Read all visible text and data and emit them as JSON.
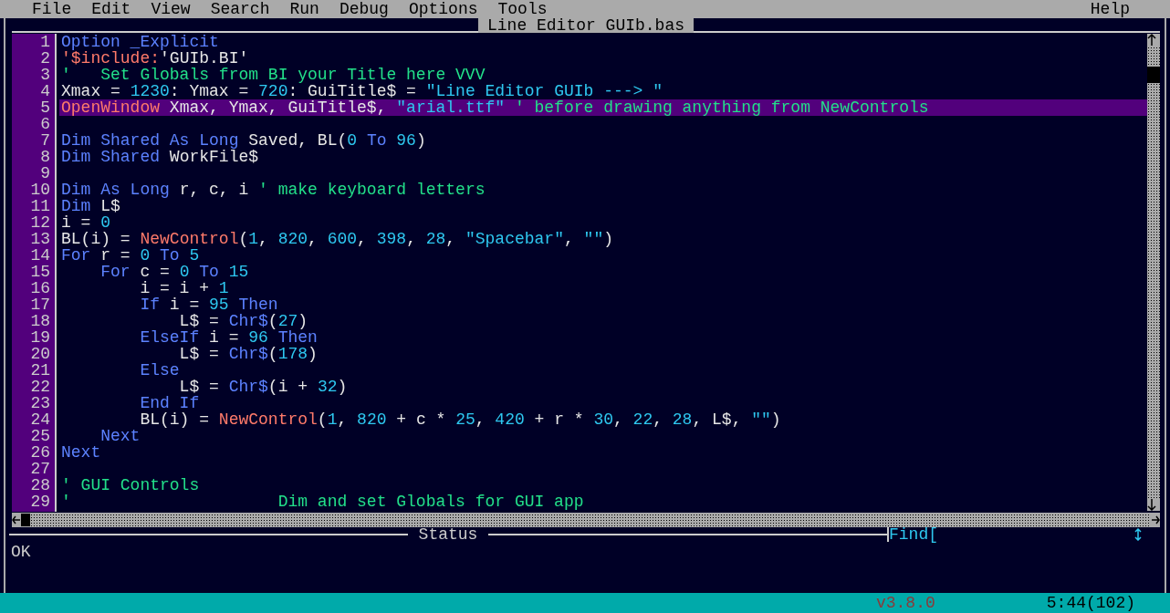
{
  "menu": [
    "File",
    "Edit",
    "View",
    "Search",
    "Run",
    "Debug",
    "Options",
    "Tools"
  ],
  "help": "Help",
  "editor": {
    "title": "Line Editor GUIb.bas",
    "lines": [
      {
        "number": "1",
        "selected": false,
        "tokens": [
          {
            "kind": "keyword",
            "text": "Option _Explicit"
          }
        ]
      },
      {
        "number": "2",
        "selected": false,
        "tokens": [
          {
            "kind": "metacommand",
            "text": "'$include:"
          },
          {
            "kind": "plain",
            "text": "'GUIb.BI'"
          }
        ]
      },
      {
        "number": "3",
        "selected": false,
        "tokens": [
          {
            "kind": "comment",
            "text": "'   Set Globals from BI your Title here VVV"
          }
        ]
      },
      {
        "number": "4",
        "selected": false,
        "tokens": [
          {
            "kind": "plain",
            "text": "Xmax = "
          },
          {
            "kind": "number",
            "text": "1230"
          },
          {
            "kind": "plain",
            "text": ": Ymax = "
          },
          {
            "kind": "number",
            "text": "720"
          },
          {
            "kind": "plain",
            "text": ": GuiTitle$ = "
          },
          {
            "kind": "string",
            "text": "\"Line Editor GUIb ---> \""
          }
        ]
      },
      {
        "number": "5",
        "selected": true,
        "tokens": [
          {
            "kind": "function",
            "text": "OpenWindow"
          },
          {
            "kind": "plain",
            "text": " Xmax, Ymax, GuiTitle$, "
          },
          {
            "kind": "string",
            "text": "\"arial.ttf\""
          },
          {
            "kind": "comment",
            "text": " ' before drawing anything from NewControls"
          }
        ]
      },
      {
        "number": "6",
        "selected": false
      },
      {
        "number": "7",
        "selected": false,
        "tokens": [
          {
            "kind": "keyword",
            "text": "Dim Shared As Long"
          },
          {
            "kind": "plain",
            "text": " Saved, BL("
          },
          {
            "kind": "number",
            "text": "0"
          },
          {
            "kind": "keyword",
            "text": " To "
          },
          {
            "kind": "number",
            "text": "96"
          },
          {
            "kind": "plain",
            "text": ")"
          }
        ]
      },
      {
        "number": "8",
        "selected": false,
        "tokens": [
          {
            "kind": "keyword",
            "text": "Dim Shared"
          },
          {
            "kind": "plain",
            "text": " WorkFile$"
          }
        ]
      },
      {
        "number": "9",
        "selected": false
      },
      {
        "number": "10",
        "selected": false,
        "tokens": [
          {
            "kind": "keyword",
            "text": "Dim As Long"
          },
          {
            "kind": "plain",
            "text": " r, c, i "
          },
          {
            "kind": "comment",
            "text": "' make keyboard letters"
          }
        ]
      },
      {
        "number": "11",
        "selected": false,
        "tokens": [
          {
            "kind": "keyword",
            "text": "Dim"
          },
          {
            "kind": "plain",
            "text": " L$"
          }
        ]
      },
      {
        "number": "12",
        "selected": false,
        "tokens": [
          {
            "kind": "plain",
            "text": "i = "
          },
          {
            "kind": "number",
            "text": "0"
          }
        ]
      },
      {
        "number": "13",
        "selected": false,
        "tokens": [
          {
            "kind": "plain",
            "text": "BL(i) = "
          },
          {
            "kind": "function",
            "text": "NewControl"
          },
          {
            "kind": "plain",
            "text": "("
          },
          {
            "kind": "number",
            "text": "1"
          },
          {
            "kind": "plain",
            "text": ", "
          },
          {
            "kind": "number",
            "text": "820"
          },
          {
            "kind": "plain",
            "text": ", "
          },
          {
            "kind": "number",
            "text": "600"
          },
          {
            "kind": "plain",
            "text": ", "
          },
          {
            "kind": "number",
            "text": "398"
          },
          {
            "kind": "plain",
            "text": ", "
          },
          {
            "kind": "number",
            "text": "28"
          },
          {
            "kind": "plain",
            "text": ", "
          },
          {
            "kind": "string",
            "text": "\"Spacebar\""
          },
          {
            "kind": "plain",
            "text": ", "
          },
          {
            "kind": "string",
            "text": "\"\""
          },
          {
            "kind": "plain",
            "text": ")"
          }
        ]
      },
      {
        "number": "14",
        "selected": false,
        "tokens": [
          {
            "kind": "keyword",
            "text": "For"
          },
          {
            "kind": "plain",
            "text": " r = "
          },
          {
            "kind": "number",
            "text": "0"
          },
          {
            "kind": "keyword",
            "text": " To "
          },
          {
            "kind": "number",
            "text": "5"
          }
        ]
      },
      {
        "number": "15",
        "selected": false,
        "tokens": [
          {
            "kind": "keyword",
            "text": "    For"
          },
          {
            "kind": "plain",
            "text": " c = "
          },
          {
            "kind": "number",
            "text": "0"
          },
          {
            "kind": "keyword",
            "text": " To "
          },
          {
            "kind": "number",
            "text": "15"
          }
        ]
      },
      {
        "number": "16",
        "selected": false,
        "tokens": [
          {
            "kind": "plain",
            "text": "        i = i + "
          },
          {
            "kind": "number",
            "text": "1"
          }
        ]
      },
      {
        "number": "17",
        "selected": false,
        "tokens": [
          {
            "kind": "keyword",
            "text": "        If"
          },
          {
            "kind": "plain",
            "text": " i = "
          },
          {
            "kind": "number",
            "text": "95"
          },
          {
            "kind": "keyword",
            "text": " Then"
          }
        ]
      },
      {
        "number": "18",
        "selected": false,
        "tokens": [
          {
            "kind": "plain",
            "text": "            L$ = "
          },
          {
            "kind": "keyword",
            "text": "Chr$"
          },
          {
            "kind": "plain",
            "text": "("
          },
          {
            "kind": "number",
            "text": "27"
          },
          {
            "kind": "plain",
            "text": ")"
          }
        ]
      },
      {
        "number": "19",
        "selected": false,
        "tokens": [
          {
            "kind": "keyword",
            "text": "        ElseIf"
          },
          {
            "kind": "plain",
            "text": " i = "
          },
          {
            "kind": "number",
            "text": "96"
          },
          {
            "kind": "keyword",
            "text": " Then"
          }
        ]
      },
      {
        "number": "20",
        "selected": false,
        "tokens": [
          {
            "kind": "plain",
            "text": "            L$ = "
          },
          {
            "kind": "keyword",
            "text": "Chr$"
          },
          {
            "kind": "plain",
            "text": "("
          },
          {
            "kind": "number",
            "text": "178"
          },
          {
            "kind": "plain",
            "text": ")"
          }
        ]
      },
      {
        "number": "21",
        "selected": false,
        "tokens": [
          {
            "kind": "keyword",
            "text": "        Else"
          }
        ]
      },
      {
        "number": "22",
        "selected": false,
        "tokens": [
          {
            "kind": "plain",
            "text": "            L$ = "
          },
          {
            "kind": "keyword",
            "text": "Chr$"
          },
          {
            "kind": "plain",
            "text": "(i + "
          },
          {
            "kind": "number",
            "text": "32"
          },
          {
            "kind": "plain",
            "text": ")"
          }
        ]
      },
      {
        "number": "23",
        "selected": false,
        "tokens": [
          {
            "kind": "keyword",
            "text": "        End If"
          }
        ]
      },
      {
        "number": "24",
        "selected": false,
        "tokens": [
          {
            "kind": "plain",
            "text": "        BL(i) = "
          },
          {
            "kind": "function",
            "text": "NewControl"
          },
          {
            "kind": "plain",
            "text": "("
          },
          {
            "kind": "number",
            "text": "1"
          },
          {
            "kind": "plain",
            "text": ", "
          },
          {
            "kind": "number",
            "text": "820"
          },
          {
            "kind": "plain",
            "text": " + c * "
          },
          {
            "kind": "number",
            "text": "25"
          },
          {
            "kind": "plain",
            "text": ", "
          },
          {
            "kind": "number",
            "text": "420"
          },
          {
            "kind": "plain",
            "text": " + r * "
          },
          {
            "kind": "number",
            "text": "30"
          },
          {
            "kind": "plain",
            "text": ", "
          },
          {
            "kind": "number",
            "text": "22"
          },
          {
            "kind": "plain",
            "text": ", "
          },
          {
            "kind": "number",
            "text": "28"
          },
          {
            "kind": "plain",
            "text": ", L$, "
          },
          {
            "kind": "string",
            "text": "\"\""
          },
          {
            "kind": "plain",
            "text": ")"
          }
        ]
      },
      {
        "number": "25",
        "selected": false,
        "tokens": [
          {
            "kind": "keyword",
            "text": "    Next"
          }
        ]
      },
      {
        "number": "26",
        "selected": false,
        "tokens": [
          {
            "kind": "keyword",
            "text": "Next"
          }
        ]
      },
      {
        "number": "27",
        "selected": false
      },
      {
        "number": "28",
        "selected": false,
        "tokens": [
          {
            "kind": "comment",
            "text": "' GUI Controls"
          }
        ]
      },
      {
        "number": "29",
        "selected": false,
        "tokens": [
          {
            "kind": "comment",
            "text": "'                     Dim and set Globals for GUI app"
          }
        ]
      }
    ]
  },
  "status": {
    "title": "Status",
    "find_label": "Find[",
    "message": "OK"
  },
  "status_bar": {
    "version": "v3.8.0",
    "position": "5:44(102)"
  }
}
